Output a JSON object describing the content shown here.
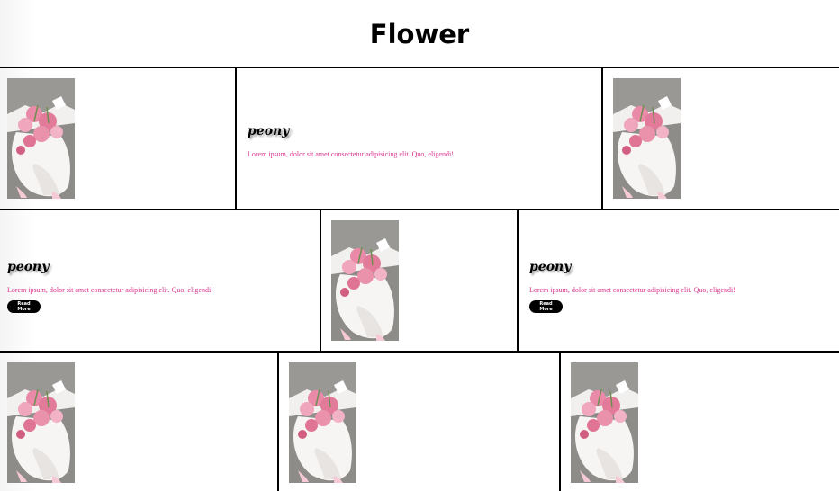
{
  "page": {
    "title": "Flower"
  },
  "image": {
    "alt": "bouquet of pink flowers"
  },
  "cards": {
    "heading": "peony",
    "text": "Lorem ipsum, dolor sit amet consectetur adipisicing elit. Quo, eligendi!",
    "button": "Read More"
  },
  "colors": {
    "text_accent": "#d6338c",
    "border": "#000000",
    "button_bg": "#000000"
  }
}
